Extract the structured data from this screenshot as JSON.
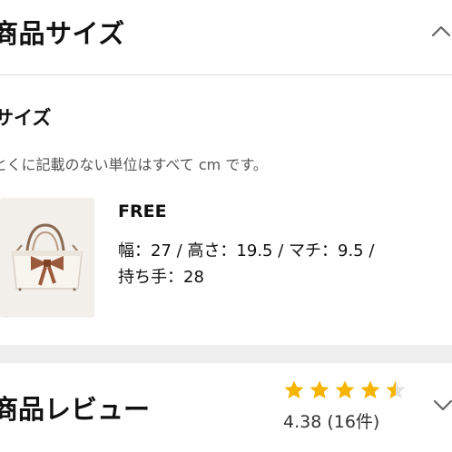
{
  "header": {
    "title": "商品サイズ"
  },
  "size_section": {
    "title": "サイズ",
    "note": "とくに記載のない単位はすべて cm です。"
  },
  "product": {
    "image_icon": "handbag-image",
    "size_label": "FREE",
    "dimensions_line1": "幅：27 / 高さ：19.5 / マチ：9.5 /",
    "dimensions_line2": "持ち手：28"
  },
  "reviews": {
    "title": "商品レビュー",
    "rating": 4.38,
    "rating_text": "4.38 (16件)",
    "star_color": "#f5b400"
  },
  "icons": {
    "collapse": "chevron-up-icon",
    "expand": "chevron-down-icon"
  }
}
